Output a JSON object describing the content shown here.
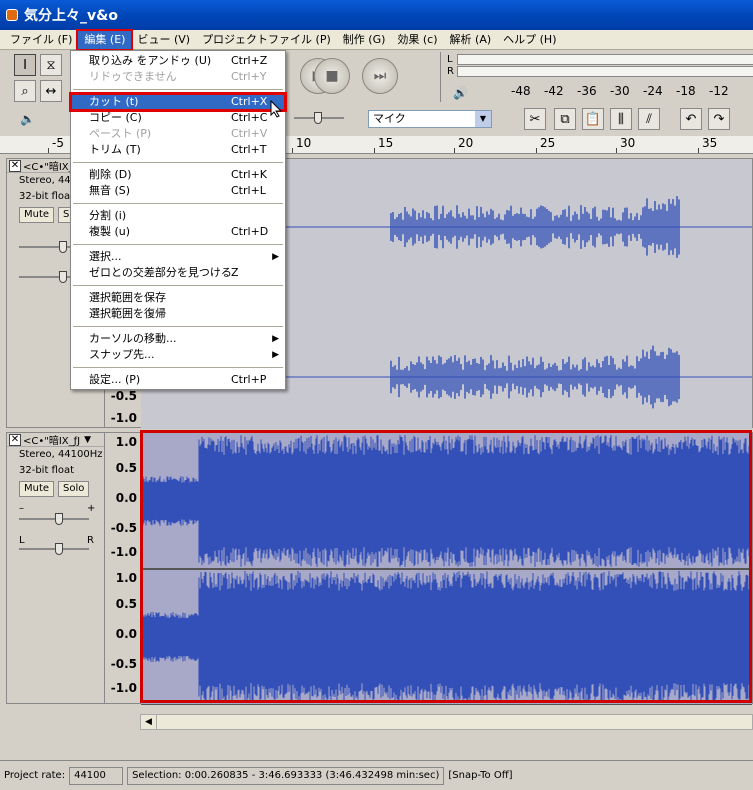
{
  "window": {
    "title": "気分上々_v&o"
  },
  "menubar": {
    "items": [
      "ファイル (F)",
      "編集 (E)",
      "ビュー (V)",
      "プロジェクトファイル (P)",
      "制作 (G)",
      "効果 (c)",
      "解析 (A)",
      "ヘルプ (H)"
    ],
    "active_index": 1
  },
  "toolbar": {
    "tools": [
      "select-cursor-icon",
      "envelope-icon",
      "zoom-icon",
      "timeshift-icon"
    ],
    "volume_icon": "speaker-icon",
    "mic_label": "マイク",
    "edit_icons": [
      "cut-icon",
      "copy-icon",
      "paste-icon",
      "trim-icon",
      "silence-icon",
      "undo-icon",
      "redo-icon"
    ]
  },
  "meter": {
    "channel_labels": [
      "L",
      "R"
    ],
    "scale": [
      "-48",
      "-42",
      "-36",
      "-30",
      "-24",
      "-18",
      "-12"
    ]
  },
  "ruler": {
    "labels": [
      "-5",
      "10",
      "15",
      "20",
      "25",
      "30",
      "35"
    ]
  },
  "edit_menu": {
    "items": [
      {
        "label": "取り込み をアンドゥ (U)",
        "shortcut": "Ctrl+Z",
        "disabled": false
      },
      {
        "label": "リドゥできません",
        "shortcut": "Ctrl+Y",
        "disabled": true
      },
      {
        "sep": true
      },
      {
        "label": "カット (t)",
        "shortcut": "Ctrl+X",
        "highlight": true
      },
      {
        "label": "コピー (C)",
        "shortcut": "Ctrl+C"
      },
      {
        "label": "ペースト (P)",
        "shortcut": "Ctrl+V",
        "disabled": true
      },
      {
        "label": "トリム (T)",
        "shortcut": "Ctrl+T"
      },
      {
        "sep": true
      },
      {
        "label": "削除 (D)",
        "shortcut": "Ctrl+K"
      },
      {
        "label": "無音 (S)",
        "shortcut": "Ctrl+L"
      },
      {
        "sep": true
      },
      {
        "label": "分割 (i)",
        "shortcut": ""
      },
      {
        "label": "複製 (u)",
        "shortcut": "Ctrl+D"
      },
      {
        "sep": true
      },
      {
        "label": "選択...",
        "shortcut": "",
        "submenu": true
      },
      {
        "label": "ゼロとの交差部分を見つける",
        "shortcut": "Z"
      },
      {
        "sep": true
      },
      {
        "label": "選択範囲を保存",
        "shortcut": ""
      },
      {
        "label": "選択範囲を復帰",
        "shortcut": ""
      },
      {
        "sep": true
      },
      {
        "label": "カーソルの移動...",
        "shortcut": "",
        "submenu": true
      },
      {
        "label": "スナップ先...",
        "shortcut": "",
        "submenu": true
      },
      {
        "sep": true
      },
      {
        "label": "設定... (P)",
        "shortcut": "Ctrl+P"
      }
    ]
  },
  "tracks": [
    {
      "name": "<C•\"暗IX_",
      "format": "Stereo, 44",
      "bits": "32-bit float",
      "mute": "Mute",
      "solo": "S",
      "scale_bottom": [
        "-0.5",
        "-1.0"
      ]
    },
    {
      "name": "<C•\"暗IX_ƒJ",
      "format": "Stereo, 44100Hz",
      "bits": "32-bit float",
      "mute": "Mute",
      "solo": "Solo",
      "pan_left": "L",
      "pan_right": "R",
      "gain_minus": "–",
      "gain_plus": "+",
      "scale": [
        "1.0",
        "0.5",
        "0.0",
        "-0.5",
        "-1.0"
      ]
    }
  ],
  "status": {
    "rate_label": "Project rate:",
    "rate_value": "44100",
    "selection": "Selection: 0:00.260835 - 3:46.693333 (3:46.432498 min:sec)",
    "snap": "[Snap-To Off]"
  },
  "colors": {
    "wave": "#3250b8",
    "wave_bg": "#c8c8d0",
    "selection_bg": "#a8a8c8",
    "highlight": "#316ac5",
    "callout": "#e00000"
  }
}
